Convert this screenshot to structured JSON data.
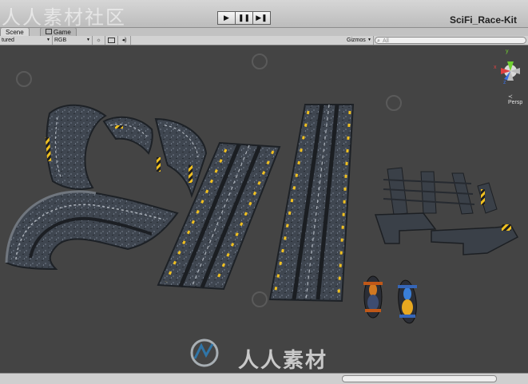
{
  "watermark": {
    "text": "人人素材社区",
    "center_text": "人人素材"
  },
  "toolbar_top": {
    "play_icon": "▶",
    "pause_icon": "❚❚",
    "step_icon": "▶❚"
  },
  "project_title": "SciFi_Race-Kit",
  "tabs": [
    {
      "label": "Scene",
      "active": true
    },
    {
      "label": "Game",
      "active": false
    }
  ],
  "scene_toolbar": {
    "draw_mode": "tured",
    "render_mode": "RGB",
    "gizmos": "Gizmos",
    "search_placeholder": "All"
  },
  "gizmo": {
    "view_label": "Persp",
    "axis_x": "x",
    "axis_y": "y",
    "axis_z": "z"
  },
  "colors": {
    "viewport_bg": "#444444",
    "accent": "#f0c020",
    "gizmo_x": "#e04040",
    "gizmo_y": "#70d030",
    "gizmo_z": "#3a6fe0"
  }
}
